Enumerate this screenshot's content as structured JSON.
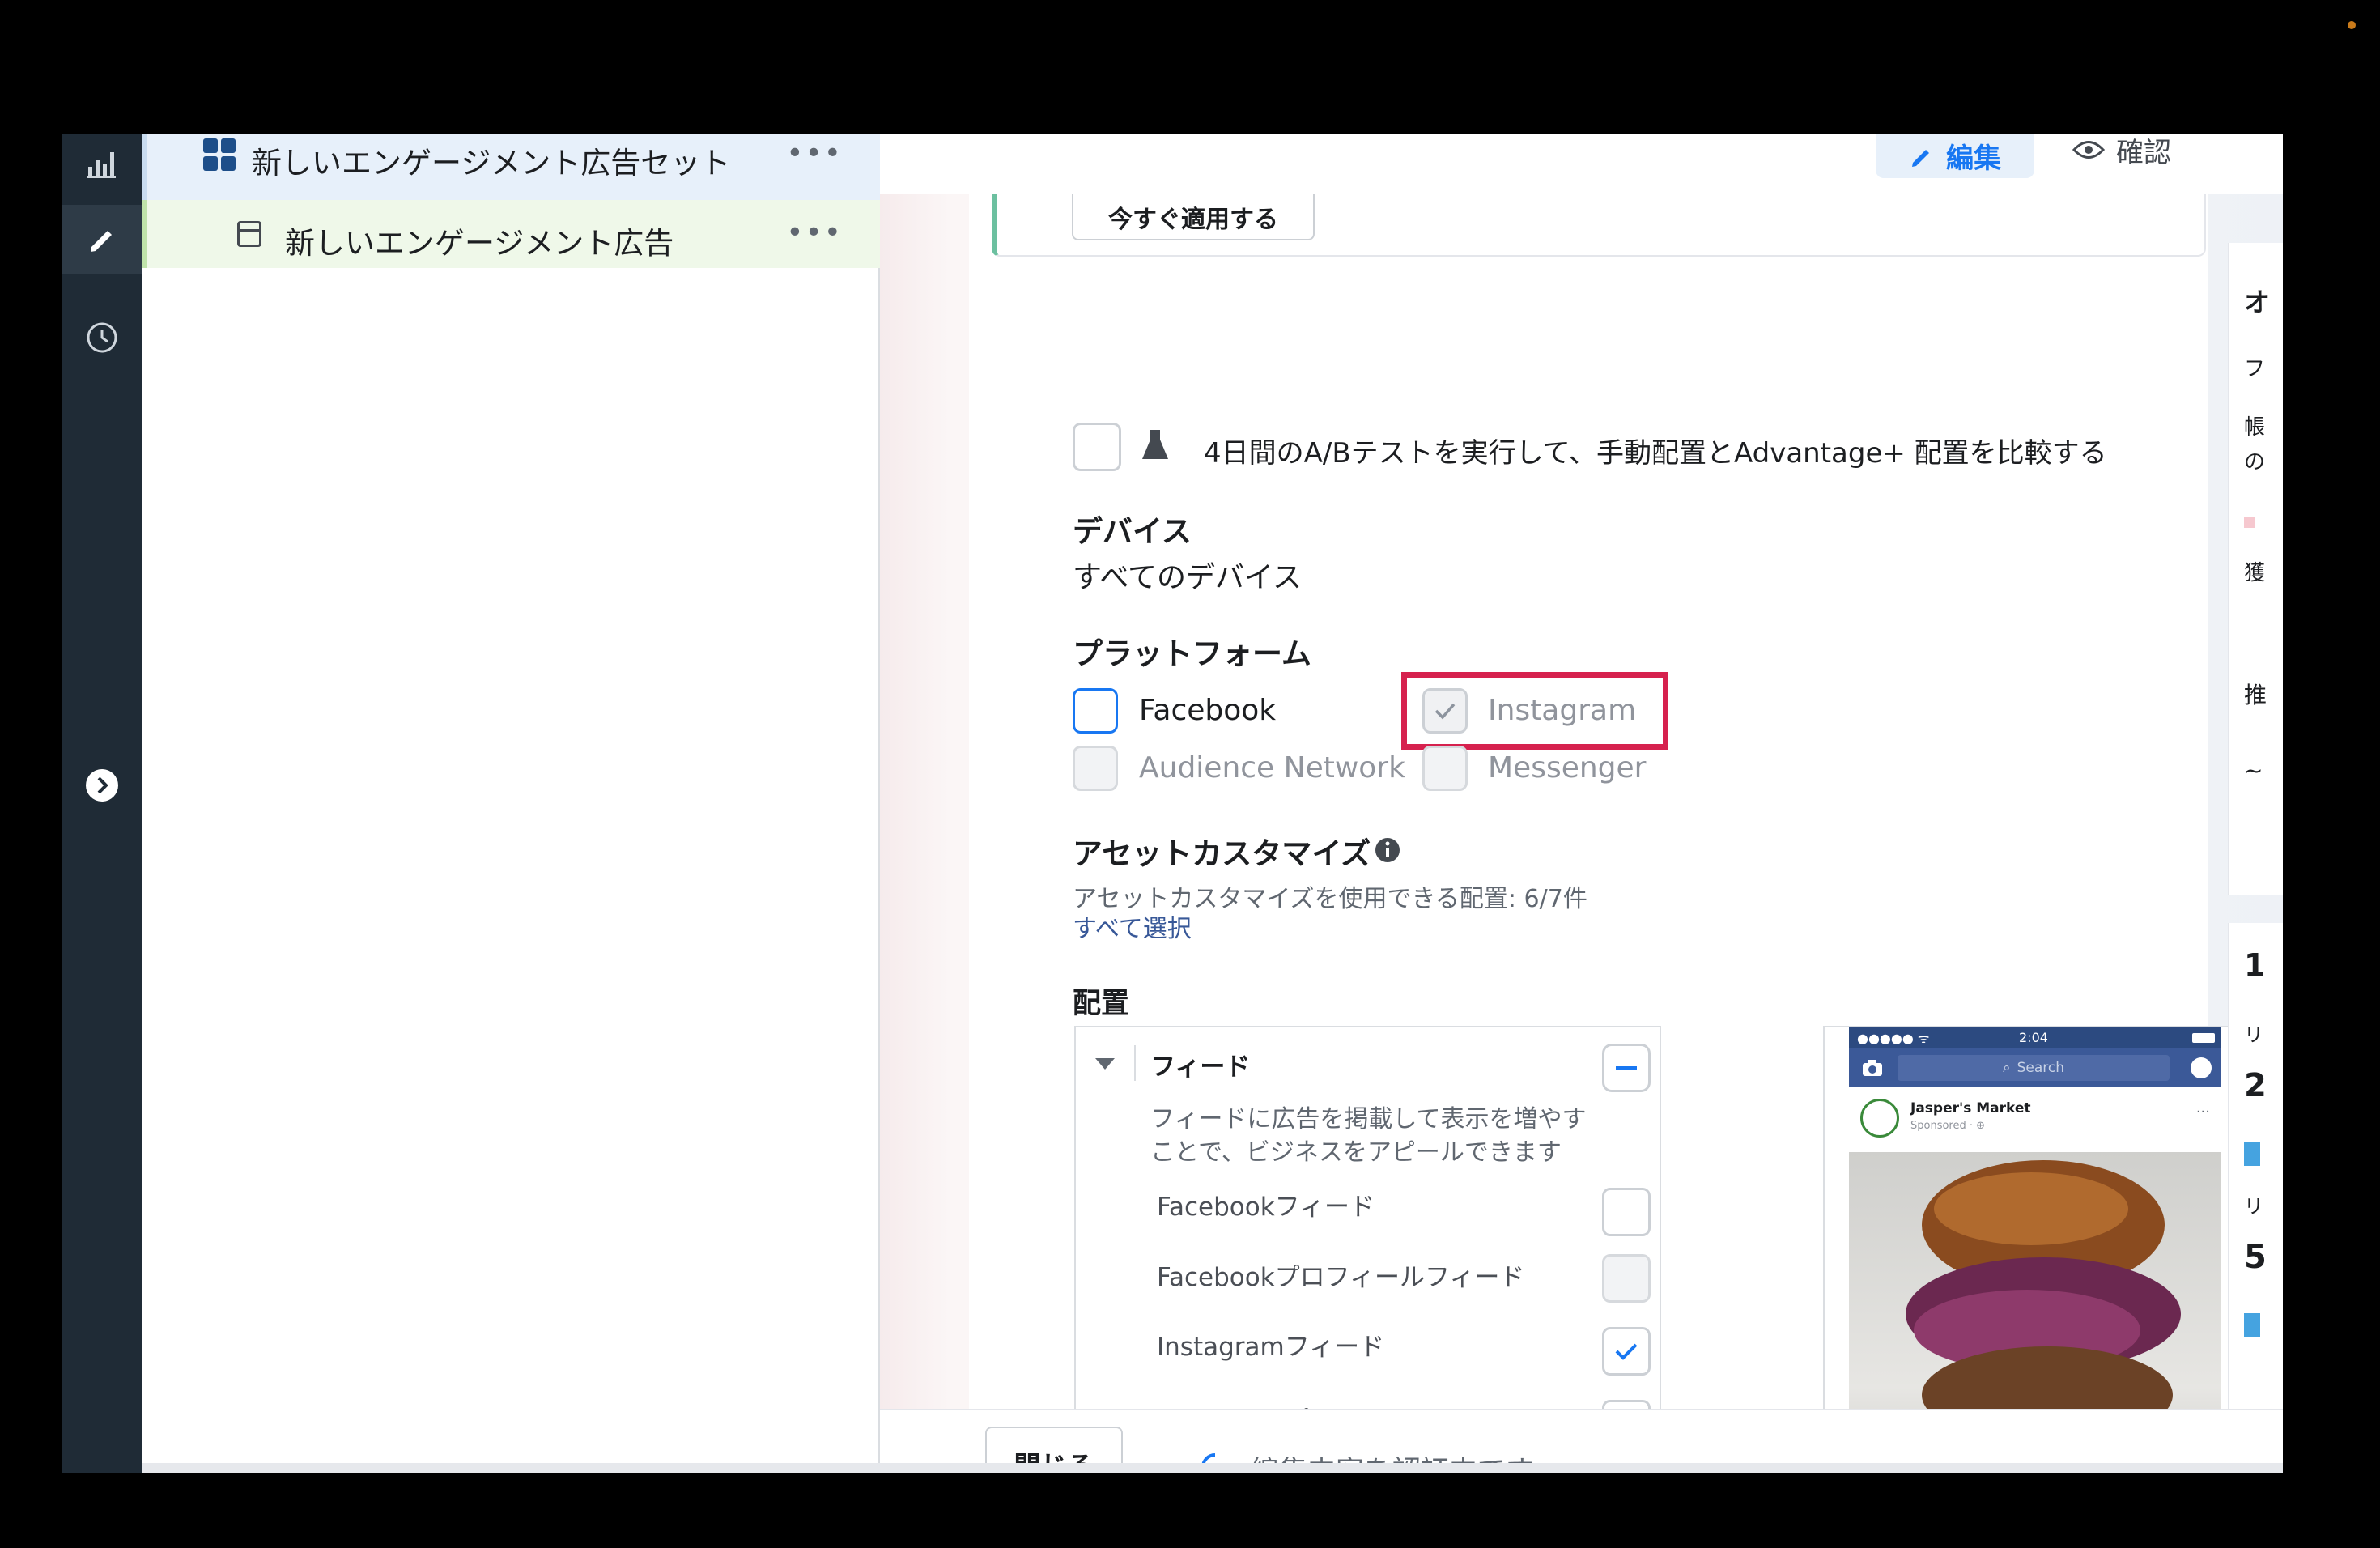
{
  "rail": {
    "icons": [
      "bar-chart-icon",
      "pencil-icon",
      "clock-icon",
      "chevron-right-circle-icon"
    ]
  },
  "tree": {
    "adset_label": "新しいエンゲージメント広告セット",
    "ad_label": "新しいエンゲージメント広告",
    "more": "•••"
  },
  "header": {
    "edit_label": "編集",
    "review_label": "確認"
  },
  "main": {
    "apply_now": "今すぐ適用する",
    "ab_test": "4日間のA/Bテストを実行して、手動配置とAdvantage+ 配置を比較する",
    "devices_heading": "デバイス",
    "devices_value": "すべてのデバイス",
    "platforms_heading": "プラットフォーム",
    "platforms": [
      {
        "label": "Facebook"
      },
      {
        "label": "Instagram"
      },
      {
        "label": "Audience Network"
      },
      {
        "label": "Messenger"
      }
    ],
    "asset_heading": "アセットカスタマイズ",
    "asset_desc": "アセットカスタマイズを使用できる配置: 6/7件",
    "select_all": "すべて選択",
    "placement_heading": "配置",
    "feed_heading": "フィード",
    "feed_desc_1": "フィードに広告を掲載して表示を増やす",
    "feed_desc_2": "ことで、ビジネスをアピールできます",
    "feed_items": [
      {
        "label": "Facebookフィード"
      },
      {
        "label": "Facebookプロフィールフィード"
      },
      {
        "label": "Instagramフィード"
      },
      {
        "label": "Instagramプロフィールフィード"
      }
    ],
    "phone": {
      "time": "2:04",
      "search": "Search",
      "page_name": "Jasper's Market",
      "sponsored": "Sponsored · ⊕"
    }
  },
  "bottom": {
    "close": "閉じる",
    "status": "編集内容を認証中です..."
  },
  "right_panel": {
    "chars": [
      "オ",
      "フ",
      "帳",
      "の",
      "獲",
      "推",
      "~",
      "1",
      "リ",
      "2",
      "リ",
      "5"
    ]
  },
  "colors": {
    "accent": "#1877f2",
    "highlight_box": "#d6214e",
    "rail_bg": "#1f2b36",
    "green_bar": "#7ec97e"
  }
}
